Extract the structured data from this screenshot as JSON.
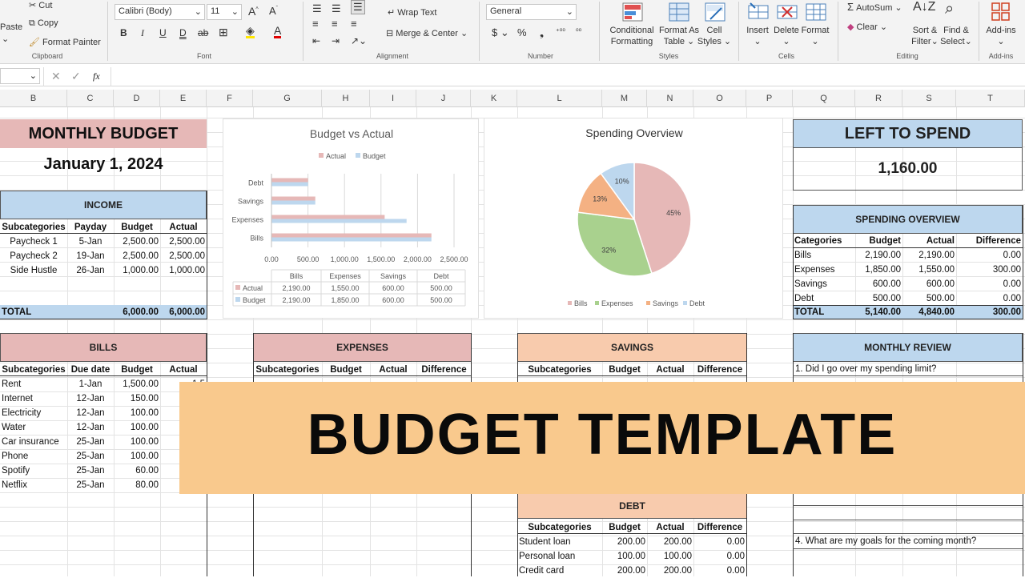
{
  "ribbon": {
    "paste": "Paste",
    "cut": "Cut",
    "copy": "Copy",
    "format_painter": "Format Painter",
    "clipboard": "Clipboard",
    "font_name": "Calibri (Body)",
    "font_size": "11",
    "font": "Font",
    "wrap_text": "Wrap Text",
    "merge_center": "Merge & Center",
    "alignment": "Alignment",
    "number_format": "General",
    "number": "Number",
    "conditional_formatting": [
      "Conditional",
      "Formatting"
    ],
    "format_as_table": [
      "Format As",
      "Table"
    ],
    "cell_styles": [
      "Cell",
      "Styles"
    ],
    "styles": "Styles",
    "insert": "Insert",
    "delete": "Delete",
    "format": "Format",
    "cells": "Cells",
    "autosum": "AutoSum",
    "clear": "Clear",
    "sort_filter": [
      "Sort &",
      "Filter"
    ],
    "find_select": [
      "Find &",
      "Select"
    ],
    "editing": "Editing",
    "addins": "Add-ins",
    "addins_group": "Add-ins"
  },
  "formula_bar": {
    "fx": "fx"
  },
  "columns": [
    "B",
    "C",
    "D",
    "E",
    "F",
    "G",
    "H",
    "I",
    "J",
    "K",
    "L",
    "M",
    "N",
    "O",
    "P",
    "Q",
    "R",
    "S",
    "T"
  ],
  "budget": {
    "title": "MONTHLY BUDGET",
    "date": "January 1, 2024"
  },
  "income": {
    "title": "INCOME",
    "headers": [
      "Subcategories",
      "Payday",
      "Budget",
      "Actual"
    ],
    "rows": [
      [
        "Paycheck 1",
        "5-Jan",
        "2,500.00",
        "2,500.00"
      ],
      [
        "Paycheck 2",
        "19-Jan",
        "2,500.00",
        "2,500.00"
      ],
      [
        "Side Hustle",
        "26-Jan",
        "1,000.00",
        "1,000.00"
      ]
    ],
    "total_label": "TOTAL",
    "total_budget": "6,000.00",
    "total_actual": "6,000.00"
  },
  "bills": {
    "title": "BILLS",
    "headers": [
      "Subcategories",
      "Due date",
      "Budget",
      "Actual"
    ],
    "rows": [
      [
        "Rent",
        "1-Jan",
        "1,500.00",
        "1,5"
      ],
      [
        "Internet",
        "12-Jan",
        "150.00",
        "1"
      ],
      [
        "Electricity",
        "12-Jan",
        "100.00",
        "1"
      ],
      [
        "Water",
        "12-Jan",
        "100.00",
        "1"
      ],
      [
        "Car insurance",
        "25-Jan",
        "100.00",
        "1"
      ],
      [
        "Phone",
        "25-Jan",
        "100.00",
        "1"
      ],
      [
        "Spotify",
        "25-Jan",
        "60.00",
        ""
      ],
      [
        "Netflix",
        "25-Jan",
        "80.00",
        ""
      ]
    ]
  },
  "expenses": {
    "title": "EXPENSES",
    "headers": [
      "Subcategories",
      "Budget",
      "Actual",
      "Difference"
    ]
  },
  "savings": {
    "title": "SAVINGS",
    "headers": [
      "Subcategories",
      "Budget",
      "Actual",
      "Difference"
    ]
  },
  "debt": {
    "title": "DEBT",
    "headers": [
      "Subcategories",
      "Budget",
      "Actual",
      "Difference"
    ],
    "rows": [
      [
        "Student loan",
        "200.00",
        "200.00",
        "0.00"
      ],
      [
        "Personal loan",
        "100.00",
        "100.00",
        "0.00"
      ],
      [
        "Credit card",
        "200.00",
        "200.00",
        "0.00"
      ]
    ]
  },
  "left_to_spend": {
    "title": "LEFT TO SPEND",
    "value": "1,160.00"
  },
  "spending_overview": {
    "title": "SPENDING OVERVIEW",
    "headers": [
      "Categories",
      "Budget",
      "Actual",
      "Difference"
    ],
    "rows": [
      [
        "Bills",
        "2,190.00",
        "2,190.00",
        "0.00"
      ],
      [
        "Expenses",
        "1,850.00",
        "1,550.00",
        "300.00"
      ],
      [
        "Savings",
        "600.00",
        "600.00",
        "0.00"
      ],
      [
        "Debt",
        "500.00",
        "500.00",
        "0.00"
      ]
    ],
    "total": [
      "TOTAL",
      "5,140.00",
      "4,840.00",
      "300.00"
    ]
  },
  "monthly_review": {
    "title": "MONTHLY REVIEW",
    "q1": "1. Did I go over my spending limit?",
    "q4": "4. What are my goals for the coming month?"
  },
  "banner": {
    "text": "BUDGET TEMPLATE"
  },
  "colors": {
    "pink": "#e6b8b7",
    "blue": "#bdd7ee",
    "orange": "#f8cbad",
    "banner": "#f9c98d",
    "pie_bills": "#e6b8b7",
    "pie_expenses": "#a9d18e",
    "pie_savings": "#f4b183",
    "pie_debt": "#bdd7ee"
  },
  "chart_data": [
    {
      "type": "bar",
      "title": "Budget vs Actual",
      "categories": [
        "Bills",
        "Expenses",
        "Savings",
        "Debt"
      ],
      "series": [
        {
          "name": "Actual",
          "values": [
            2190,
            1550,
            600,
            500
          ],
          "color": "#e6b8b7"
        },
        {
          "name": "Budget",
          "values": [
            2190,
            1850,
            600,
            500
          ],
          "color": "#bdd7ee"
        }
      ],
      "xlim": [
        0,
        2500
      ],
      "ticks": [
        "0.00",
        "500.00",
        "1,000.00",
        "1,500.00",
        "2,000.00",
        "2,500.00"
      ],
      "table_values": {
        "Actual": [
          "2,190.00",
          "1,550.00",
          "600.00",
          "500.00"
        ],
        "Budget": [
          "2,190.00",
          "1,850.00",
          "600.00",
          "500.00"
        ]
      },
      "legend": "top"
    },
    {
      "type": "pie",
      "title": "Spending Overview",
      "labels": [
        "Bills",
        "Expenses",
        "Savings",
        "Debt"
      ],
      "values": [
        45,
        32,
        13,
        10
      ],
      "value_labels": [
        "45%",
        "32%",
        "13%",
        "10%"
      ],
      "legend": "bottom"
    }
  ]
}
